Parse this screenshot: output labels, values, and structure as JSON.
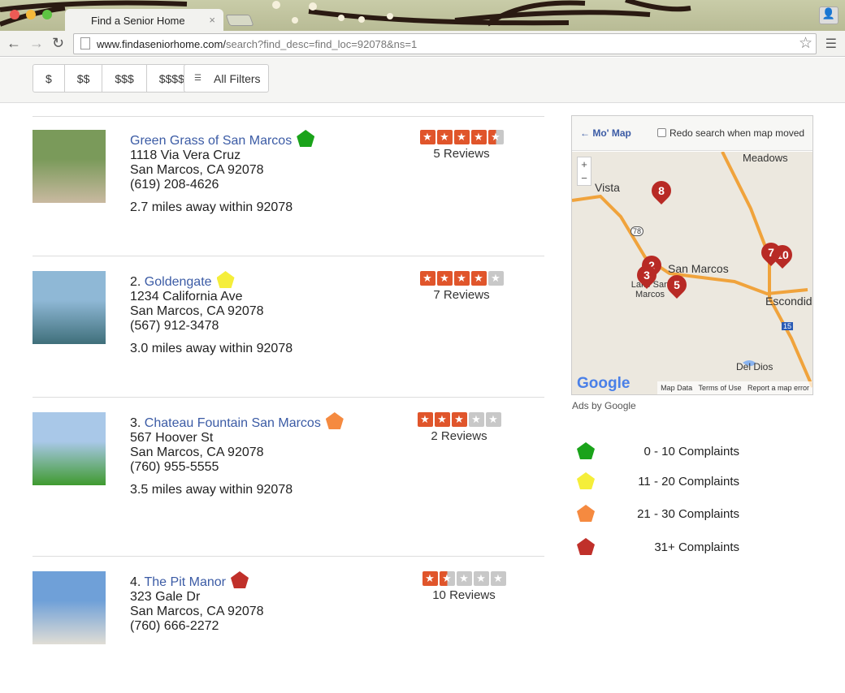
{
  "browser": {
    "tab_title": "Find a Senior Home",
    "url_host": "www.findaseniorhome.com/",
    "url_path": "search?find_desc=find_loc=92078&ns=1"
  },
  "filters": {
    "prices": [
      "$",
      "$$",
      "$$$",
      "$$$$"
    ],
    "all_filters": "All Filters"
  },
  "listings": [
    {
      "number": "",
      "name": "Green Grass of San Marcos",
      "address": "1118 Via Vera Cruz",
      "city": "San Marcos, CA 92078",
      "phone": "(619) 208-4626",
      "distance": "2.7 miles away within 92078",
      "rating": 4.5,
      "reviews": "5 Reviews",
      "complaint_color": "#1aa31a",
      "photo": [
        "#7a9a5a",
        "#c9b9a0"
      ]
    },
    {
      "number": "2.",
      "name": "Goldengate",
      "address": "1234 California Ave",
      "city": "San Marcos, CA 92078",
      "phone": "(567) 912-3478",
      "distance": "3.0 miles away within 92078",
      "rating": 4,
      "reviews": "7 Reviews",
      "complaint_color": "#f5ee3a",
      "photo": [
        "#8fb8d6",
        "#3f6f7a"
      ]
    },
    {
      "number": "3.",
      "name": "Chateau Fountain San Marcos",
      "address": "567 Hoover St",
      "city": "San Marcos, CA 92078",
      "phone": "(760) 955-5555",
      "distance": "3.5 miles away within 92078",
      "rating": 3,
      "reviews": "2 Reviews",
      "complaint_color": "#f58a40",
      "photo": [
        "#a9c8e8",
        "#3f9a2f"
      ]
    },
    {
      "number": "4.",
      "name": "The Pit Manor",
      "address": "323 Gale Dr",
      "city": "San Marcos, CA 92078",
      "phone": "(760) 666-2272",
      "distance": "",
      "rating": 1.5,
      "reviews": "10 Reviews",
      "complaint_color": "#c0302a",
      "photo": [
        "#6fa0d8",
        "#e0ddd5"
      ]
    }
  ],
  "map": {
    "back_link": "Mo' Map",
    "redo_label": "Redo search when map moved",
    "places": [
      "Meadows",
      "Vista",
      "San Marcos",
      "Lake San Marcos",
      "Escondido",
      "Del Dios"
    ],
    "route_78": "78",
    "route_15": "15",
    "pins": [
      "8",
      "2",
      "3",
      "5",
      "7",
      "10"
    ],
    "logo": "Google",
    "attribution": [
      "Map Data",
      "Terms of Use",
      "Report a map error"
    ],
    "zoom_in": "+",
    "zoom_out": "−"
  },
  "ads_label": "Ads by Google",
  "legend": [
    {
      "label": "0 - 10 Complaints",
      "color": "#1aa31a"
    },
    {
      "label": "11 - 20 Complaints",
      "color": "#f5ee3a"
    },
    {
      "label": "21 - 30 Complaints",
      "color": "#f58a40"
    },
    {
      "label": "31+ Complaints",
      "color": "#c0302a"
    }
  ],
  "colors": {
    "star_on": "#e0552b",
    "star_off": "#c8c8c8",
    "link": "#3b5ba5"
  }
}
